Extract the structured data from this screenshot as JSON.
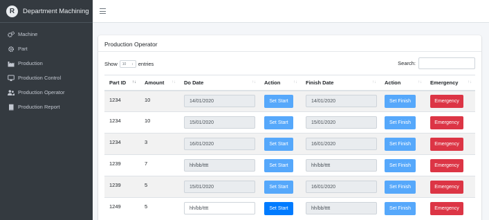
{
  "sidebar": {
    "brand": "Department Machining",
    "brand_logo": "R",
    "items": [
      {
        "label": "Machine",
        "icon": "cogs-icon"
      },
      {
        "label": "Part",
        "icon": "gear-icon"
      },
      {
        "label": "Production",
        "icon": "industry-icon"
      },
      {
        "label": "Production Control",
        "icon": "desktop-icon"
      },
      {
        "label": "Production Operator",
        "icon": "users-icon"
      },
      {
        "label": "Production Report",
        "icon": "book-icon"
      }
    ]
  },
  "topbar": {
    "menu_icon": "hamburger-icon"
  },
  "card": {
    "title": "Production Operator",
    "show_label": "Show",
    "length_value": "10",
    "entries_label": "entries",
    "search_label": "Search:",
    "search_value": ""
  },
  "table": {
    "columns": [
      "Part ID",
      "Amount",
      "Do Date",
      "Action",
      "Finish Date",
      "Action",
      "Emergency"
    ],
    "sort_active": "↑↓",
    "sort_inactive": "↑↓",
    "rows": [
      {
        "part_id": "1234",
        "amount": "10",
        "do_date": "14/01/2020",
        "start": "Set Start",
        "finish_date": "14/01/2020",
        "finish": "Set Finish",
        "emergency": "Emergency"
      },
      {
        "part_id": "1234",
        "amount": "10",
        "do_date": "15/01/2020",
        "start": "Set Start",
        "finish_date": "15/01/2020",
        "finish": "Set Finish",
        "emergency": "Emergency"
      },
      {
        "part_id": "1234",
        "amount": "3",
        "do_date": "16/01/2020",
        "start": "Set Start",
        "finish_date": "16/01/2020",
        "finish": "Set Finish",
        "emergency": "Emergency"
      },
      {
        "part_id": "1239",
        "amount": "7",
        "do_date": "hh/bb/tttt",
        "start": "Set Start",
        "finish_date": "hh/bb/tttt",
        "finish": "Set Finish",
        "emergency": "Emergency"
      },
      {
        "part_id": "1239",
        "amount": "5",
        "do_date": "15/01/2020",
        "start": "Set Start",
        "finish_date": "16/01/2020",
        "finish": "Set Finish",
        "emergency": "Emergency"
      },
      {
        "part_id": "1249",
        "amount": "5",
        "do_date": "hh/bb/tttt",
        "start": "Set Start",
        "finish_date": "hh/bb/tttt",
        "finish": "Set Finish",
        "emergency": "Emergency"
      }
    ]
  },
  "colors": {
    "sidebar_bg": "#343a40",
    "primary_light": "#56a8fb",
    "primary": "#007bff",
    "danger": "#dc3545"
  }
}
